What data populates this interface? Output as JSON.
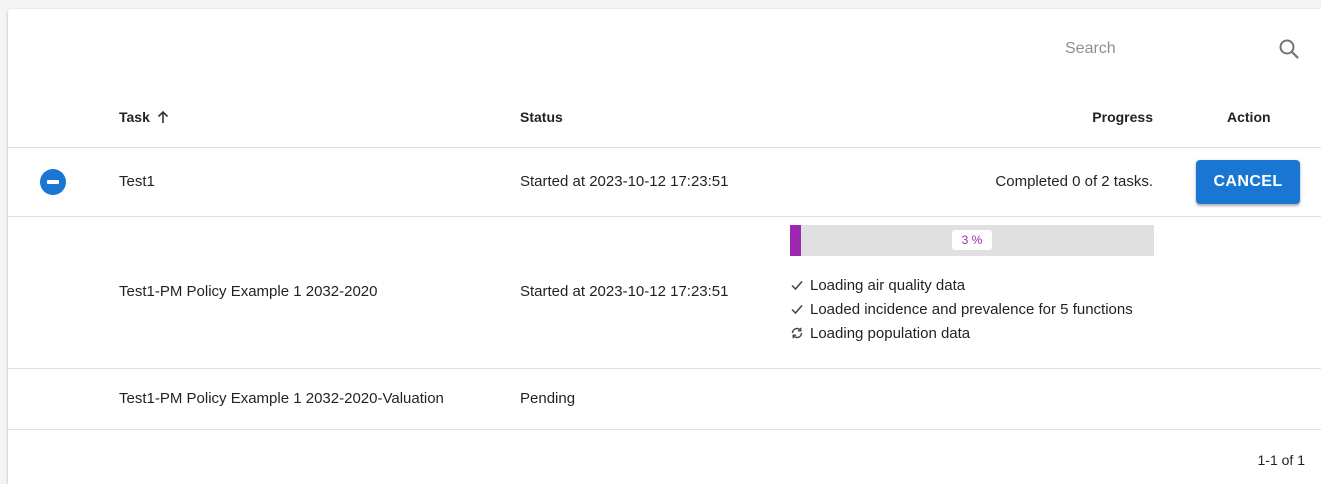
{
  "search": {
    "placeholder": "Search"
  },
  "table": {
    "headers": {
      "task": "Task",
      "status": "Status",
      "progress": "Progress",
      "action": "Action"
    },
    "sort": {
      "column": "task",
      "direction": "ascending"
    },
    "rows": [
      {
        "task": "Test1",
        "status": "Started at 2023-10-12 17:23:51",
        "progress_text": "Completed 0 of 2 tasks.",
        "action_label": "CANCEL",
        "expanded": true
      },
      {
        "task": "Test1-PM Policy Example 1 2032-2020",
        "status": "Started at 2023-10-12 17:23:51",
        "progress_percent": 3,
        "progress_label": "3 %",
        "steps": [
          {
            "icon": "check-icon",
            "text": "Loading air quality data"
          },
          {
            "icon": "check-icon",
            "text": "Loaded incidence and prevalence for 5 functions"
          },
          {
            "icon": "sync-icon",
            "text": "Loading population data"
          }
        ]
      },
      {
        "task": "Test1-PM Policy Example 1 2032-2020-Valuation",
        "status": "Pending"
      }
    ]
  },
  "pagination": {
    "range_text": "1-1 of 1"
  },
  "colors": {
    "primary": "#1976d2",
    "progress": "#9c27b0",
    "progress_track": "#e0e0e0",
    "divider": "#e0e0e0"
  }
}
